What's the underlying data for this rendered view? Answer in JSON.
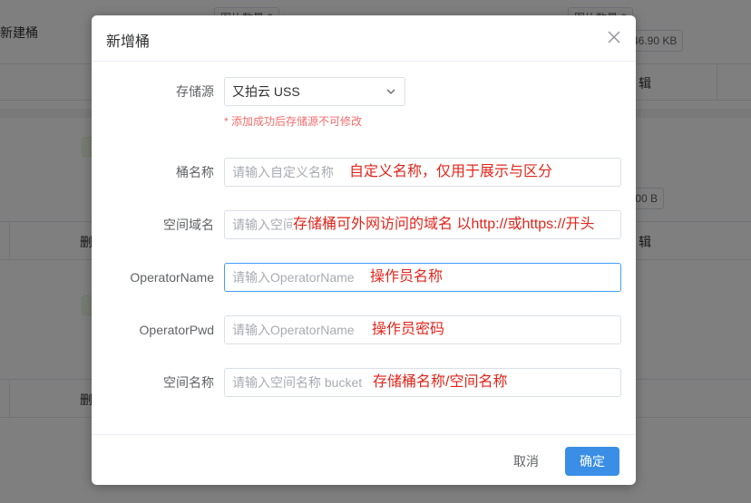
{
  "background": {
    "bucket_name": "新建桶",
    "image_count_label_1": "图片数量",
    "image_count_value_1": "0",
    "image_count_label_2": "图片数量",
    "image_count_value_2": "0",
    "size_1": "46.90 KB",
    "size_2": ".00 B",
    "edit_1": "辑",
    "edit_2": "辑",
    "delete_1": "删",
    "delete_2": "删"
  },
  "dialog": {
    "title": "新增桶",
    "close_icon": "close-icon",
    "storage_label": "存储源",
    "storage_value": "又拍云 USS",
    "storage_hint": "* 添加成功后存储源不可修改",
    "fields": [
      {
        "label": "桶名称",
        "placeholder": "请输入自定义名称",
        "annotation": "自定义名称，仅用于展示与区分"
      },
      {
        "label": "空间域名",
        "placeholder": "请输入空间域名",
        "annotation": "存储桶可外网访问的域名 以http://或https://开头"
      },
      {
        "label": "OperatorName",
        "placeholder": "请输入OperatorName",
        "annotation": "操作员名称"
      },
      {
        "label": "OperatorPwd",
        "placeholder": "请输入OperatorName",
        "annotation": "操作员密码"
      },
      {
        "label": "空间名称",
        "placeholder": "请输入空间名称 bucket",
        "annotation": "存储桶名称/空间名称"
      }
    ],
    "cancel_label": "取消",
    "confirm_label": "确定"
  },
  "colors": {
    "primary": "#3a8ee6",
    "annotation_red": "#e0261c",
    "hint_red": "#f56c6c"
  }
}
